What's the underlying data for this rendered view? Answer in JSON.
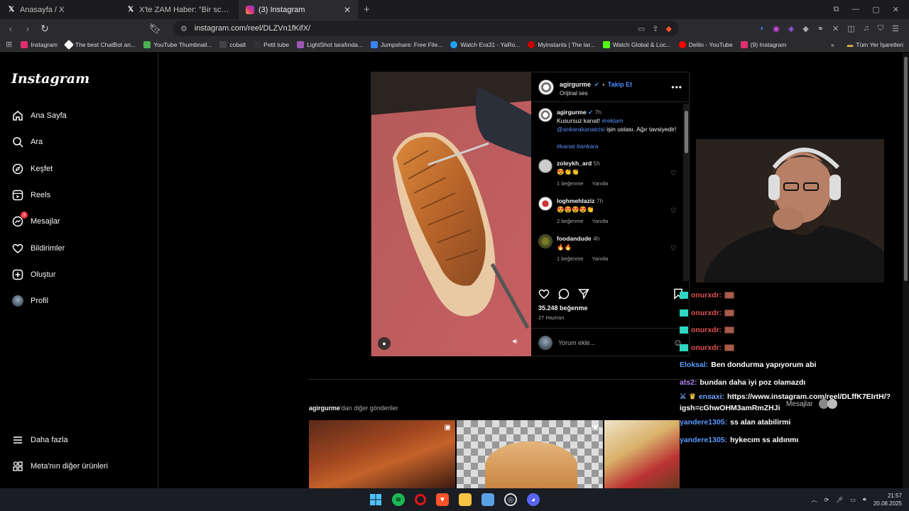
{
  "tabs": [
    {
      "title": "Anasayfa / X",
      "icon": "x-logo-icon"
    },
    {
      "title": "X'te ZAM Haber: \"Bir scooter sürücüs",
      "icon": "x-logo-icon"
    },
    {
      "title": "(3) Instagram",
      "icon": "instagram-icon",
      "active": true
    }
  ],
  "address": {
    "url": "instagram.com/reel/DLZVn1fKifX/"
  },
  "bookmarks": [
    {
      "label": "Instagram",
      "color": "#e1306c"
    },
    {
      "label": "The best ChatBot an...",
      "color": "#ffffff"
    },
    {
      "label": "YouTube Thumbnail...",
      "color": "#ff0000"
    },
    {
      "label": "cobalt",
      "color": "#333333"
    },
    {
      "label": "Petit tube",
      "color": "#222222"
    },
    {
      "label": "LightShot tarafında...",
      "color": "#9b59b6"
    },
    {
      "label": "Jumpshare: Free File...",
      "color": "#3b82f6"
    },
    {
      "label": "Watch Era31 - YaRo...",
      "color": "#1da1f2"
    },
    {
      "label": "Myinstants | The lar...",
      "color": "#cc0000"
    },
    {
      "label": "Watch Global & Loc...",
      "color": "#53fc18"
    },
    {
      "label": "Delilo - YouTube",
      "color": "#ff0000"
    },
    {
      "label": "(9) Instagram",
      "color": "#e1306c"
    }
  ],
  "bookmarks_other": "Tüm Yer İşaretleri",
  "sidebar": {
    "logo": "Instagram",
    "items": [
      {
        "label": "Ana Sayfa",
        "icon": "home-icon"
      },
      {
        "label": "Ara",
        "icon": "search-icon"
      },
      {
        "label": "Keşfet",
        "icon": "compass-icon"
      },
      {
        "label": "Reels",
        "icon": "reels-icon"
      },
      {
        "label": "Mesajlar",
        "icon": "messenger-icon",
        "badge": "3"
      },
      {
        "label": "Bildirimler",
        "icon": "heart-icon"
      },
      {
        "label": "Oluştur",
        "icon": "plus-icon"
      },
      {
        "label": "Profil",
        "icon": "avatar"
      }
    ],
    "more": "Daha fazla",
    "meta": "Meta'nın diğer ürünleri"
  },
  "post": {
    "username": "agirgurme",
    "follow": "Takip Et",
    "audio": "Orijinal ses",
    "caption": {
      "username": "agirgurme",
      "time": "7h",
      "text1": "Kusursuz kanat!",
      "tag1": "#reklam",
      "mention": "@ankarakanatcisi",
      "text2": "işin ustası. Ağır tavsiyedir!",
      "tags": "#kanat #ankara"
    },
    "comments": [
      {
        "user": "zoleykh_ard",
        "time": "5h",
        "text": "😍👏👏",
        "likes": "1 beğenme",
        "reply": "Yanıtla"
      },
      {
        "user": "loghmehlaziz",
        "time": "7h",
        "text": "😍😍😍😍👏",
        "likes": "2 beğenme",
        "reply": "Yanıtla"
      },
      {
        "user": "foodandude",
        "time": "4h",
        "text": "🔥🔥",
        "likes": "1 beğenme",
        "reply": "Yanıtla"
      }
    ],
    "likes": "35.248 beğenme",
    "date": "27 Haziran",
    "comment_placeholder": "Yorum ekle..."
  },
  "more_posts": {
    "username": "agirgurme",
    "suffix": "'dan diğer gönderiler"
  },
  "chat": [
    {
      "name": "onurxdr:",
      "color": "#e05050",
      "msg": "",
      "emote": true,
      "hat": true
    },
    {
      "name": "onurxdr:",
      "color": "#e05050",
      "msg": "",
      "emote": true,
      "hat": true
    },
    {
      "name": "onurxdr:",
      "color": "#e05050",
      "msg": "",
      "emote": true,
      "hat": true
    },
    {
      "name": "onurxdr:",
      "color": "#e05050",
      "msg": "",
      "emote": true,
      "hat": true
    },
    {
      "name": "Eloksal:",
      "color": "#5b9bff",
      "msg": "Ben dondurma yapıyorum abi"
    },
    {
      "name": "ats2:",
      "color": "#b084f5",
      "msg": "bundan daha iyi poz olamazdı"
    },
    {
      "name": "ensaxi:",
      "color": "#6ea8ff",
      "msg": "https://www.instagram.com/reel/DLffK7EIrtH/?"
    },
    {
      "name": "",
      "color": "#ffffff",
      "msg": "igsh=cGhwOHM3amRmZHJi"
    },
    {
      "name": "yandere1305:",
      "color": "#5b9bff",
      "msg": "ss alan atabilirmi"
    },
    {
      "name": "yandere1305:",
      "color": "#5b9bff",
      "msg": "hykecım ss aldınmı"
    }
  ],
  "messages_popup": "Mesajlar",
  "taskbar": {
    "time": "21:57",
    "date": "20.08.2025"
  }
}
